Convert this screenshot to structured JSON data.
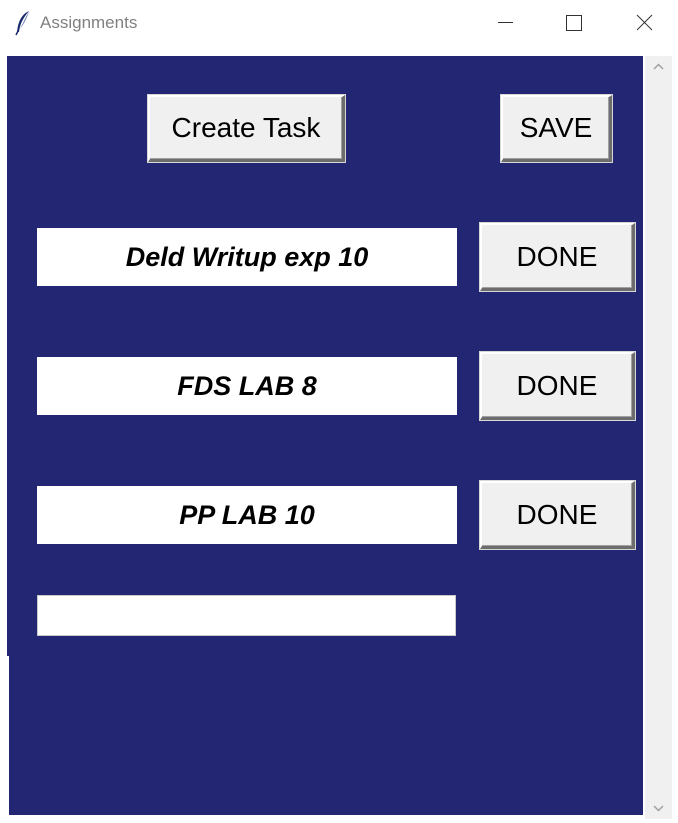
{
  "window": {
    "title": "Assignments"
  },
  "toolbar": {
    "create_label": "Create Task",
    "save_label": "SAVE"
  },
  "tasks": [
    {
      "name": "Deld Writup exp 10",
      "done_label": "DONE"
    },
    {
      "name": "FDS LAB 8",
      "done_label": "DONE"
    },
    {
      "name": "PP LAB 10",
      "done_label": "DONE"
    }
  ],
  "new_task": {
    "value": "",
    "placeholder": ""
  },
  "colors": {
    "content_background": "#232673",
    "button_face": "#f0f0f0",
    "field_background": "#ffffff"
  },
  "icons": {
    "app": "feather-icon",
    "minimize": "minimize-icon",
    "maximize": "maximize-icon",
    "close": "close-icon",
    "scroll_up": "chevron-up-icon",
    "scroll_down": "chevron-down-icon"
  }
}
